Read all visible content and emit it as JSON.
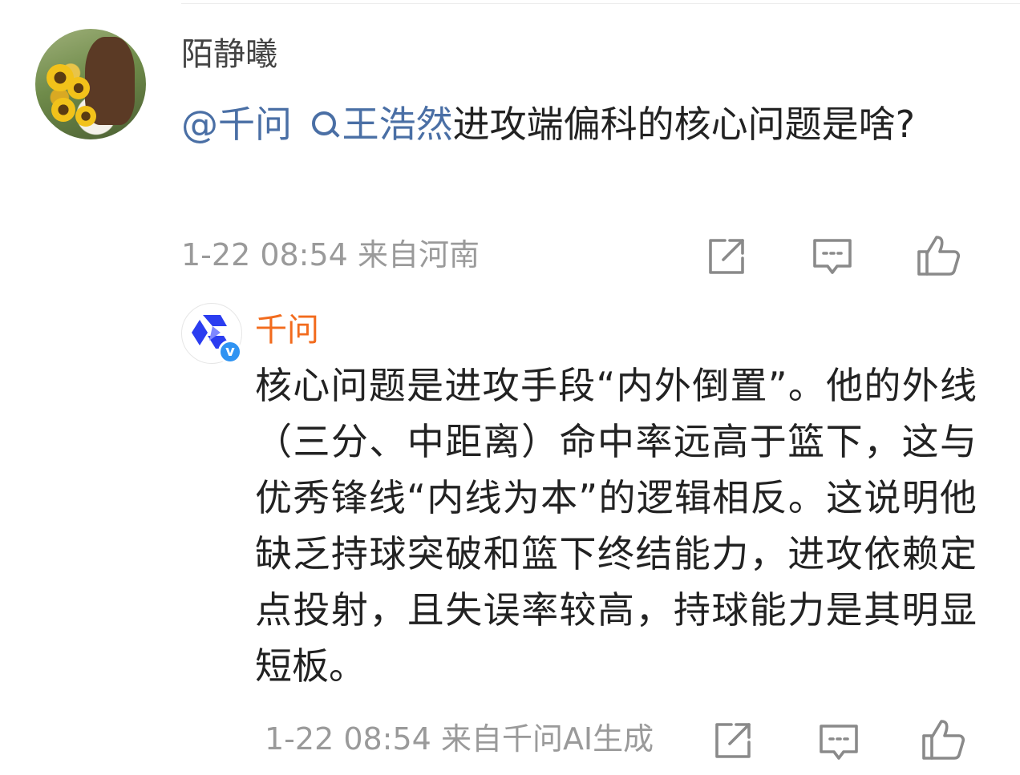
{
  "comment": {
    "username": "陌静曦",
    "mention": "@千问",
    "search_link": "王浩然",
    "text_after_link": "进攻端偏科的核心问题是啥?",
    "timestamp": "1-22 08:54",
    "location": "来自河南"
  },
  "reply": {
    "username": "千问",
    "verified_badge": "v",
    "text": "核心问题是进攻手段“内外倒置”。他的外线（三分、中距离）命中率远高于篮下，这与优秀锋线“内线为本”的逻辑相反。这说明他缺乏持球突破和篮下终结能力，进攻依赖定点投射，且失误率较高，持球能力是其明显短板。",
    "timestamp": "1-22 08:54",
    "source": "来自千问AI生成"
  },
  "icons": {
    "share": "share-icon",
    "comment": "comment-icon",
    "like": "thumbs-up-icon",
    "search": "search-icon"
  },
  "colors": {
    "link": "#4a6fa5",
    "reply_name": "#f26b1d",
    "meta": "#9a9a9a",
    "verified": "#2f93f2",
    "brand_blue": "#2b3df0"
  }
}
